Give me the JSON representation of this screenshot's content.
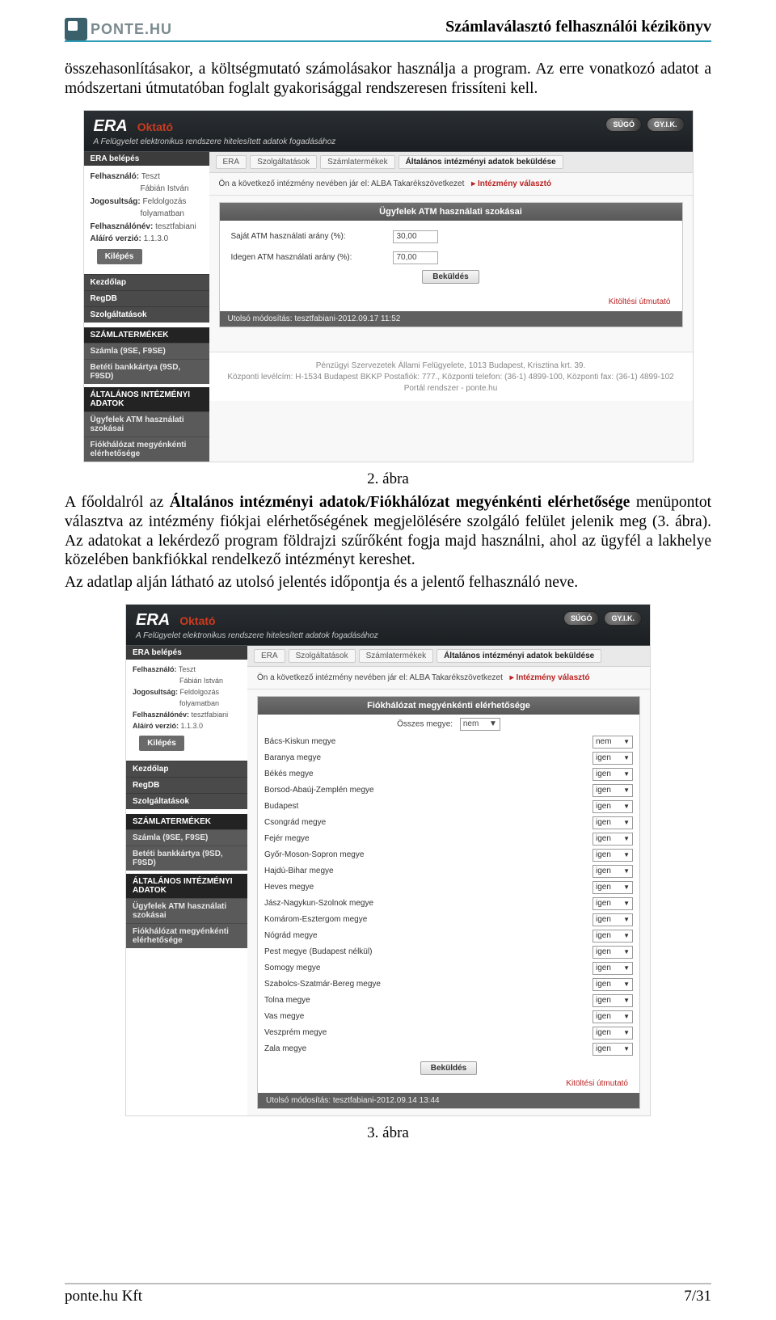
{
  "doc": {
    "logo_text": "PONTE.HU",
    "header_title": "Számlaválasztó felhasználói kézikönyv",
    "para1": "összehasonlításakor, a költségmutató számolásakor használja a program. Az erre vonatkozó adatot a módszertani útmutatóban foglalt gyakorisággal rendszeresen frissíteni kell.",
    "caption1": "2. ábra",
    "para2_prefix": "A főoldalról az ",
    "para2_bold": "Általános intézményi adatok/Fiókhálózat megyénkénti elérhetősége",
    "para2_rest": " menüpontot választva az intézmény fiókjai elérhetőségének megjelölésére szolgáló felület jelenik meg (3. ábra). Az adatokat a lekérdező program földrajzi szűrőként fogja majd használni, ahol az ügyfél a lakhelye közelében bankfiókkal rendelkező intézményt kereshet.",
    "para3": "Az adatlap alján látható az utolsó jelentés időpontja és a jelentő felhasználó neve.",
    "caption2": "3. ábra",
    "footer_left": "ponte.hu Kft",
    "footer_right": "7/31"
  },
  "shot": {
    "era": "ERA",
    "oktato": "Oktató",
    "subtitle": "A Felügyelet elektronikus rendszere hitelesített adatok fogadásához",
    "topbtn_sugo": "SÚGÓ",
    "topbtn_gyik": "GY.I.K.",
    "sidebar": {
      "login_title": "ERA belépés",
      "user_label": "Felhasználó:",
      "user_value": "Teszt\nFábián István",
      "role_label": "Jogosultság:",
      "role_value": "Feldolgozás folyamatban",
      "loginname_label": "Felhasználónév:",
      "loginname_value": "tesztfabiani",
      "signver_label": "Aláíró verzió:",
      "signver_value": "1.1.3.0",
      "exit": "Kilépés",
      "nav": [
        "Kezdőlap",
        "RegDB",
        "Szolgáltatások"
      ],
      "group1_title": "SZÁMLATERMÉKEK",
      "group1_items": [
        "Számla (9SE, F9SE)",
        "Betéti bankkártya (9SD, F9SD)"
      ],
      "group2_title": "ÁLTALÁNOS INTÉZMÉNYI ADATOK",
      "group2_items": [
        "Ügyfelek ATM használati szokásai",
        "Fiókhálózat megyénkénti elérhetősége"
      ]
    },
    "crumbs": [
      "ERA",
      "Szolgáltatások",
      "Számlatermékek",
      "Általános intézményi adatok beküldése"
    ],
    "notice_text": "Ön a következő intézmény nevében jár el: ALBA Takarékszövetkezet",
    "notice_link": "▸ Intézmény választó",
    "panel1": {
      "title": "Ügyfelek ATM használati szokásai",
      "field1_label": "Saját ATM használati arány (%):",
      "field1_value": "30,00",
      "field2_label": "Idegen ATM használati arány (%):",
      "field2_value": "70,00",
      "submit": "Beküldés",
      "guide": "Kitöltési útmutató",
      "footer": "Utolsó módosítás: tesztfabiani-2012.09.17 11:52"
    },
    "panel2": {
      "title": "Fiókhálózat megyénkénti elérhetősége",
      "all_label": "Összes megye:",
      "all_value": "nem",
      "submit": "Beküldés",
      "guide": "Kitöltési útmutató",
      "footer": "Utolsó módosítás: tesztfabiani-2012.09.14 13:44",
      "counties": [
        {
          "name": "Bács-Kiskun megye",
          "val": "nem"
        },
        {
          "name": "Baranya megye",
          "val": "igen"
        },
        {
          "name": "Békés megye",
          "val": "igen"
        },
        {
          "name": "Borsod-Abaúj-Zemplén megye",
          "val": "igen"
        },
        {
          "name": "Budapest",
          "val": "igen"
        },
        {
          "name": "Csongrád megye",
          "val": "igen"
        },
        {
          "name": "Fejér megye",
          "val": "igen"
        },
        {
          "name": "Győr-Moson-Sopron megye",
          "val": "igen"
        },
        {
          "name": "Hajdú-Bihar megye",
          "val": "igen"
        },
        {
          "name": "Heves megye",
          "val": "igen"
        },
        {
          "name": "Jász-Nagykun-Szolnok megye",
          "val": "igen"
        },
        {
          "name": "Komárom-Esztergom megye",
          "val": "igen"
        },
        {
          "name": "Nógrád megye",
          "val": "igen"
        },
        {
          "name": "Pest megye (Budapest nélkül)",
          "val": "igen"
        },
        {
          "name": "Somogy megye",
          "val": "igen"
        },
        {
          "name": "Szabolcs-Szatmár-Bereg megye",
          "val": "igen"
        },
        {
          "name": "Tolna megye",
          "val": "igen"
        },
        {
          "name": "Vas megye",
          "val": "igen"
        },
        {
          "name": "Veszprém megye",
          "val": "igen"
        },
        {
          "name": "Zala megye",
          "val": "igen"
        }
      ]
    },
    "site_footer1": "Pénzügyi Szervezetek Állami Felügyelete, 1013 Budapest, Krisztina krt. 39.",
    "site_footer2": "Központi levélcím: H-1534 Budapest BKKP Postafiók: 777., Központi telefon: (36-1) 4899-100, Központi fax: (36-1) 4899-102",
    "site_footer3": "Portál rendszer - ponte.hu"
  }
}
